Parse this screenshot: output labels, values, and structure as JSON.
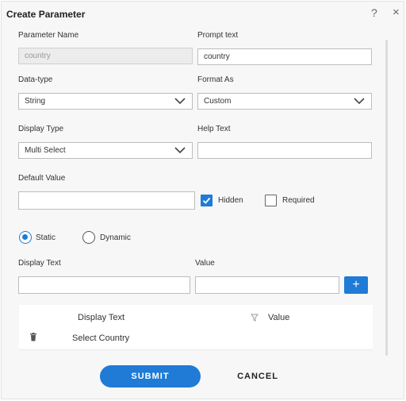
{
  "dialog": {
    "title": "Create Parameter",
    "help_icon": "?",
    "close_icon": "×"
  },
  "form": {
    "parameter_name_label": "Parameter Name",
    "parameter_name_value": "country",
    "prompt_text_label": "Prompt text",
    "prompt_text_value": "country",
    "data_type_label": "Data-type",
    "data_type_value": "String",
    "format_as_label": "Format As",
    "format_as_value": "Custom",
    "display_type_label": "Display Type",
    "display_type_value": "Multi Select",
    "help_text_label": "Help Text",
    "help_text_value": "",
    "default_value_label": "Default Value",
    "default_value_value": "",
    "hidden_label": "Hidden",
    "hidden_checked": true,
    "required_label": "Required",
    "required_checked": false
  },
  "source": {
    "static_label": "Static",
    "dynamic_label": "Dynamic",
    "selected": "Static"
  },
  "entry": {
    "display_text_label": "Display Text",
    "value_label": "Value",
    "display_text_value": "",
    "value_value": "",
    "add_button": "+"
  },
  "table": {
    "columns": [
      "Display Text",
      "Value"
    ],
    "rows": [
      {
        "display_text": "Select Country",
        "value": ""
      }
    ]
  },
  "actions": {
    "submit_label": "SUBMIT",
    "cancel_label": "CANCEL"
  },
  "colors": {
    "accent": "#1f7bd6"
  }
}
